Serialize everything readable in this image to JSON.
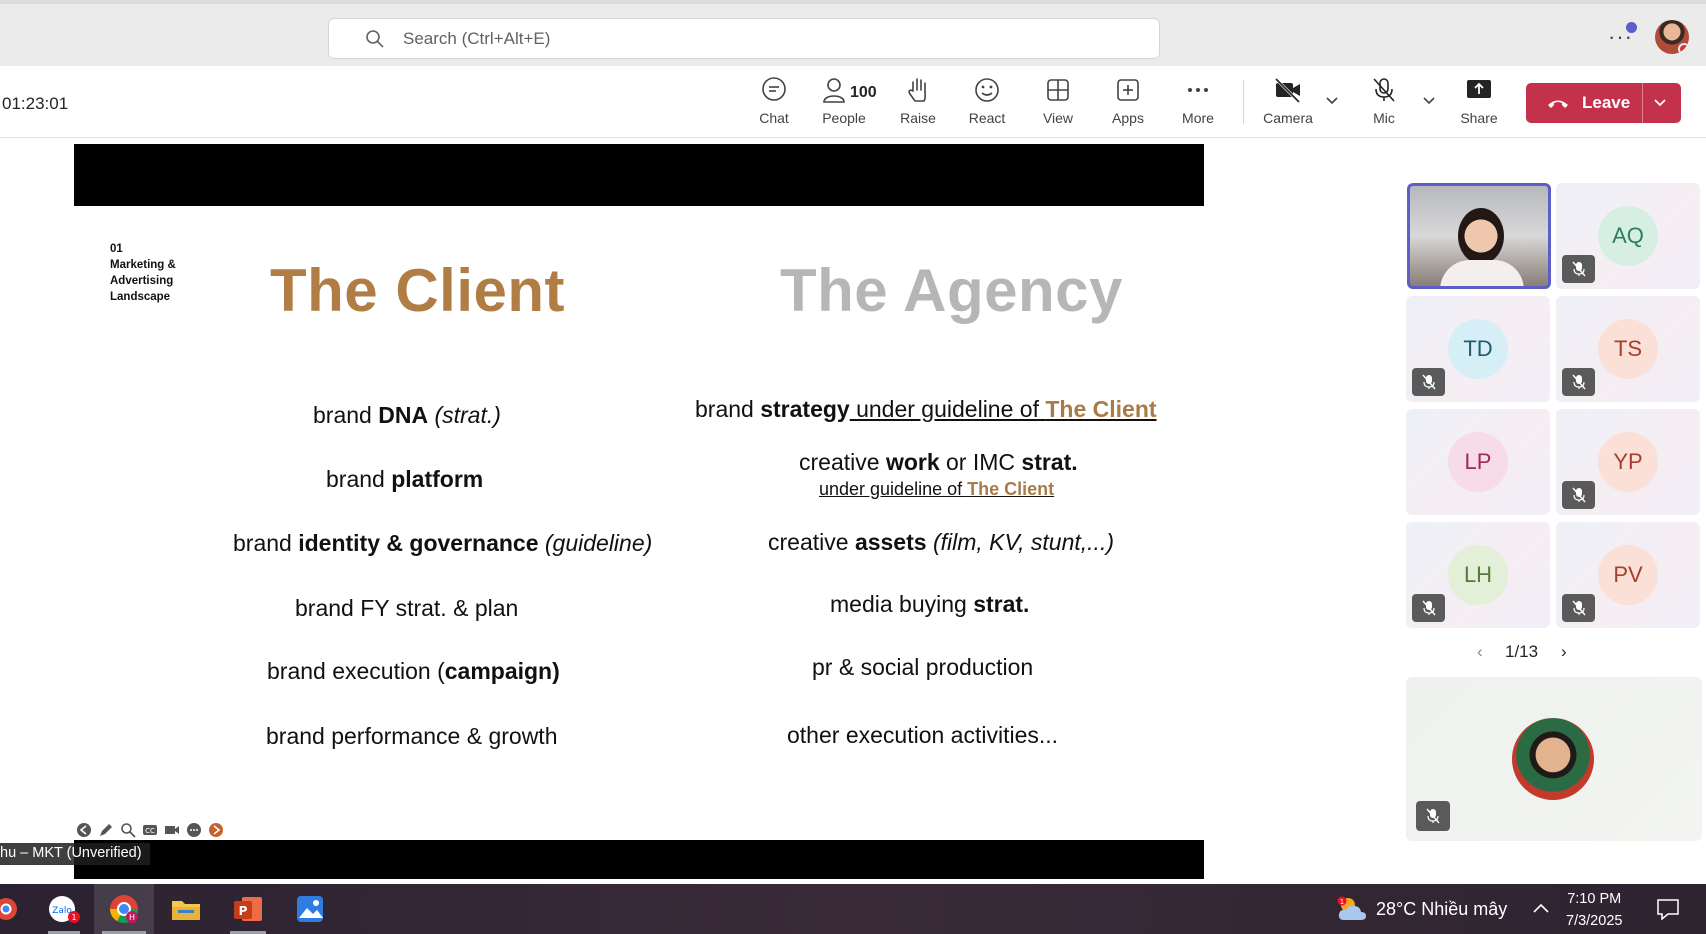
{
  "search": {
    "placeholder": "Search (Ctrl+Alt+E)"
  },
  "meeting": {
    "timer": "01:23:01"
  },
  "controls": [
    {
      "label": "Chat"
    },
    {
      "label": "People",
      "count": "100"
    },
    {
      "label": "Raise"
    },
    {
      "label": "React"
    },
    {
      "label": "View"
    },
    {
      "label": "Apps"
    },
    {
      "label": "More"
    },
    {
      "label": "Camera"
    },
    {
      "label": "Mic"
    },
    {
      "label": "Share"
    }
  ],
  "leave": {
    "label": "Leave"
  },
  "slide": {
    "tag": [
      "01",
      "Marketing &",
      "Advertising",
      "Landscape"
    ],
    "client_title": "The Client",
    "agency_title": "The Agency",
    "client_items": [
      {
        "pre": "brand ",
        "bold": "DNA",
        "post": " ",
        "italic": "(strat.)"
      },
      {
        "pre": "brand ",
        "bold": "platform",
        "post": "",
        "italic": ""
      },
      {
        "pre": "brand ",
        "bold": "identity & governance",
        "post": " ",
        "italic": "(guideline)"
      },
      {
        "pre": "brand FY strat. & plan",
        "bold": "",
        "post": "",
        "italic": ""
      },
      {
        "pre": "brand execution (",
        "bold": "campaign)",
        "post": "",
        "italic": ""
      },
      {
        "pre": "brand performance & growth",
        "bold": "",
        "post": "",
        "italic": ""
      }
    ],
    "agency_items": {
      "a1_pre": "brand ",
      "a1_bold": "strategy",
      "a1_under": " under guideline of ",
      "a1_gold": "The Client",
      "a2_pre": "creative ",
      "a2_bold": "work",
      "a2_mid": " or IMC ",
      "a2_bold2": "strat.",
      "a2_sub": "under guideline of ",
      "a2_sub_gold": "The Client",
      "a3_pre": "creative ",
      "a3_bold": "assets",
      "a3_italic": " (film, KV, stunt,...)",
      "a4_pre": "media buying ",
      "a4_bold": "strat.",
      "a5": "pr & social production",
      "a6": "other execution activities..."
    }
  },
  "presenter_name": "hu – MKT (Unverified)",
  "participants": [
    {
      "initials": "AQ",
      "color": "#2e7d5b",
      "bg": "#d7efe3"
    },
    {
      "initials": "TD",
      "color": "#1f5c6e",
      "bg": "#d6eef5"
    },
    {
      "initials": "TS",
      "color": "#a3402d",
      "bg": "#fbe0d8"
    },
    {
      "initials": "LP",
      "color": "#a1285a",
      "bg": "#f7dbe7"
    },
    {
      "initials": "YP",
      "color": "#a3402d",
      "bg": "#fbe0d8"
    },
    {
      "initials": "LH",
      "color": "#557a3b",
      "bg": "#e3efd6"
    },
    {
      "initials": "PV",
      "color": "#a3402d",
      "bg": "#fbe0d8"
    }
  ],
  "pager": {
    "label": "1/13"
  },
  "taskbar": {
    "weather": "28°C  Nhiều mây",
    "time": "7:10 PM",
    "date": "7/3/2025"
  }
}
